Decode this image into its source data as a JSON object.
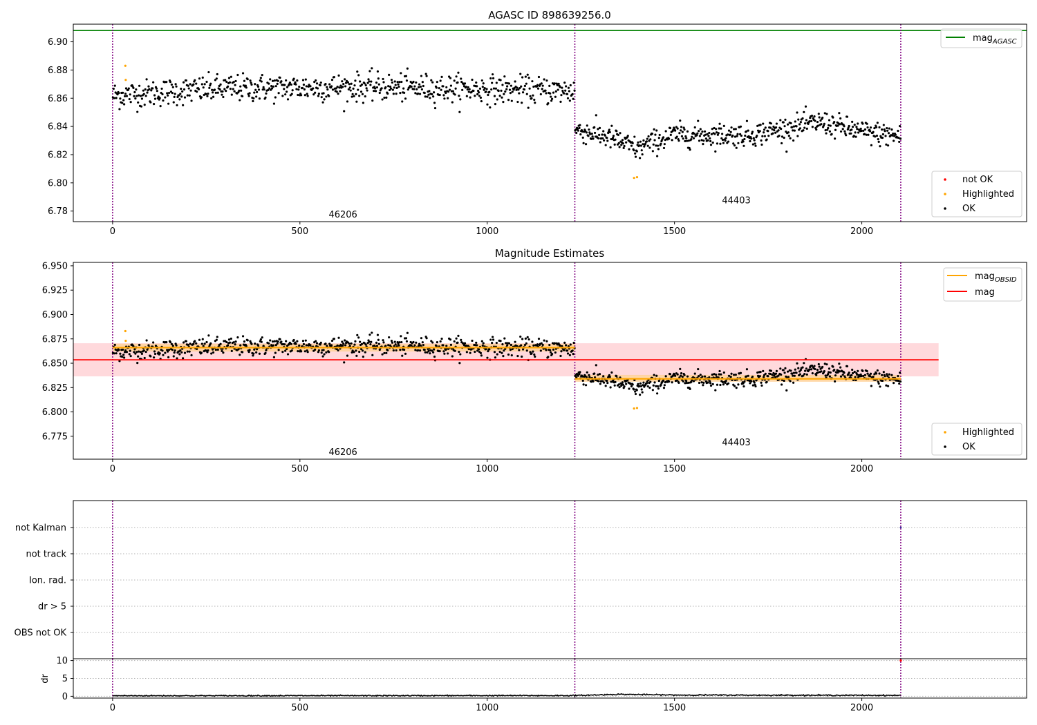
{
  "figure": {
    "style": {
      "ok_color": "#000000",
      "highlight_color": "#ffa500",
      "not_ok_color": "#ff0000",
      "agasc_line_color": "#008000",
      "obsid_mag_color": "#ffa500",
      "mag_color": "#ff0000",
      "mag_band_color": "#ffd9dc",
      "vline_color": "#800080",
      "grid_color": "#b0b0b0"
    },
    "obsids": [
      {
        "label": "46206",
        "label_x": 615,
        "start": 0,
        "end": 1234
      },
      {
        "label": "44403",
        "label_x": 1665,
        "start": 1234,
        "end": 2104
      }
    ],
    "vlines": [
      0,
      1234,
      2104
    ]
  },
  "chart_data": [
    {
      "type": "scatter",
      "id": "agasc",
      "title": "AGASC ID 898639256.0",
      "xlim": [
        -105,
        2440
      ],
      "ylim": [
        6.7725,
        6.9125
      ],
      "xticks": [
        0,
        500,
        1000,
        1500,
        2000
      ],
      "xtick_labels": [
        "0",
        "500",
        "1000",
        "1500",
        "2000"
      ],
      "yticks": [
        6.78,
        6.8,
        6.82,
        6.84,
        6.86,
        6.88,
        6.9
      ],
      "ytick_labels": [
        "6.78",
        "6.80",
        "6.82",
        "6.84",
        "6.86",
        "6.88",
        "6.90"
      ],
      "hline": {
        "name": "mag_AGASC",
        "y": 6.908
      },
      "legend_top": [
        {
          "label": "mag",
          "sub": "AGASC",
          "kind": "line",
          "color": "#008000"
        }
      ],
      "legend_bottom": [
        {
          "label": "not OK",
          "kind": "dot",
          "color": "#ff0000"
        },
        {
          "label": "Highlighted",
          "kind": "dot",
          "color": "#ffa500"
        },
        {
          "label": "OK",
          "kind": "dot",
          "color": "#000000"
        }
      ],
      "obsid_label_y": [
        6.7775,
        6.7875
      ],
      "series": [
        {
          "name": "OK",
          "segments": [
            {
              "x0": 0,
              "x1": 1234,
              "level_points": [
                [
                  0,
                  6.862
                ],
                [
                  300,
                  6.867
                ],
                [
                  700,
                  6.868
                ],
                [
                  1234,
                  6.865
                ]
              ],
              "spread": 0.0065,
              "count": 700
            },
            {
              "x0": 1234,
              "x1": 1410,
              "level_points": [
                [
                  1234,
                  6.838
                ],
                [
                  1330,
                  6.832
                ],
                [
                  1410,
                  6.823
                ]
              ],
              "spread": 0.0055,
              "count": 110
            },
            {
              "x0": 1410,
              "x1": 2104,
              "level_points": [
                [
                  1410,
                  6.826
                ],
                [
                  1500,
                  6.834
                ],
                [
                  1700,
                  6.834
                ],
                [
                  1890,
                  6.843
                ],
                [
                  2000,
                  6.836
                ],
                [
                  2104,
                  6.833
                ]
              ],
              "spread": 0.0055,
              "count": 420
            }
          ]
        },
        {
          "name": "Highlighted",
          "points": [
            [
              34,
              6.883
            ],
            [
              35,
              6.873
            ],
            [
              1392,
              6.8035
            ],
            [
              1400,
              6.804
            ]
          ]
        }
      ]
    },
    {
      "type": "scatter",
      "id": "estimates",
      "title": "Magnitude Estimates",
      "xlim": [
        -105,
        2440
      ],
      "ylim": [
        6.7515,
        6.9535
      ],
      "xticks": [
        0,
        500,
        1000,
        1500,
        2000
      ],
      "xtick_labels": [
        "0",
        "500",
        "1000",
        "1500",
        "2000"
      ],
      "yticks": [
        6.775,
        6.8,
        6.825,
        6.85,
        6.875,
        6.9,
        6.925,
        6.95
      ],
      "ytick_labels": [
        "6.775",
        "6.800",
        "6.825",
        "6.850",
        "6.875",
        "6.900",
        "6.925",
        "6.950"
      ],
      "mag": {
        "y": 6.8535,
        "band": [
          6.8365,
          6.8705
        ],
        "x_range": [
          -105,
          2205
        ]
      },
      "obsid_mags": [
        {
          "x0": 0,
          "x1": 1234,
          "y": 6.866,
          "band": [
            6.862,
            6.87
          ]
        },
        {
          "x0": 1234,
          "x1": 2104,
          "y": 6.834,
          "band": [
            6.831,
            6.838
          ]
        }
      ],
      "legend_top": [
        {
          "label": "mag",
          "sub": "OBSID",
          "kind": "line",
          "color": "#ffa500"
        },
        {
          "label": "mag",
          "sub": "",
          "kind": "line",
          "color": "#ff0000"
        }
      ],
      "legend_bottom": [
        {
          "label": "Highlighted",
          "kind": "dot",
          "color": "#ffa500"
        },
        {
          "label": "OK",
          "kind": "dot",
          "color": "#000000"
        }
      ],
      "obsid_label_y": [
        6.7585,
        6.7685
      ]
    },
    {
      "type": "scatter",
      "id": "flags",
      "categories": [
        "OBS not OK",
        "dr > 5",
        "Ion. rad.",
        "not track",
        "not Kalman"
      ],
      "xlim": [
        -105,
        2440
      ],
      "flag_points": [
        {
          "x": 2104,
          "category": "not Kalman"
        }
      ]
    },
    {
      "type": "line",
      "id": "dr",
      "ylabel": "dr",
      "xlim": [
        -105,
        2440
      ],
      "ylim": [
        -0.5,
        10.5
      ],
      "yticks": [
        0,
        5,
        10
      ],
      "ytick_labels": [
        "0",
        "5",
        "10"
      ],
      "xticks": [
        0,
        500,
        1000,
        1500,
        2000
      ],
      "xtick_labels": [
        "0",
        "500",
        "1000",
        "1500",
        "2000"
      ],
      "dr_levels": [
        [
          0,
          0.15
        ],
        [
          1234,
          0.2
        ],
        [
          1350,
          0.55
        ],
        [
          1500,
          0.35
        ],
        [
          2104,
          0.25
        ]
      ],
      "spike": {
        "x": 2104,
        "y": 10
      }
    }
  ]
}
